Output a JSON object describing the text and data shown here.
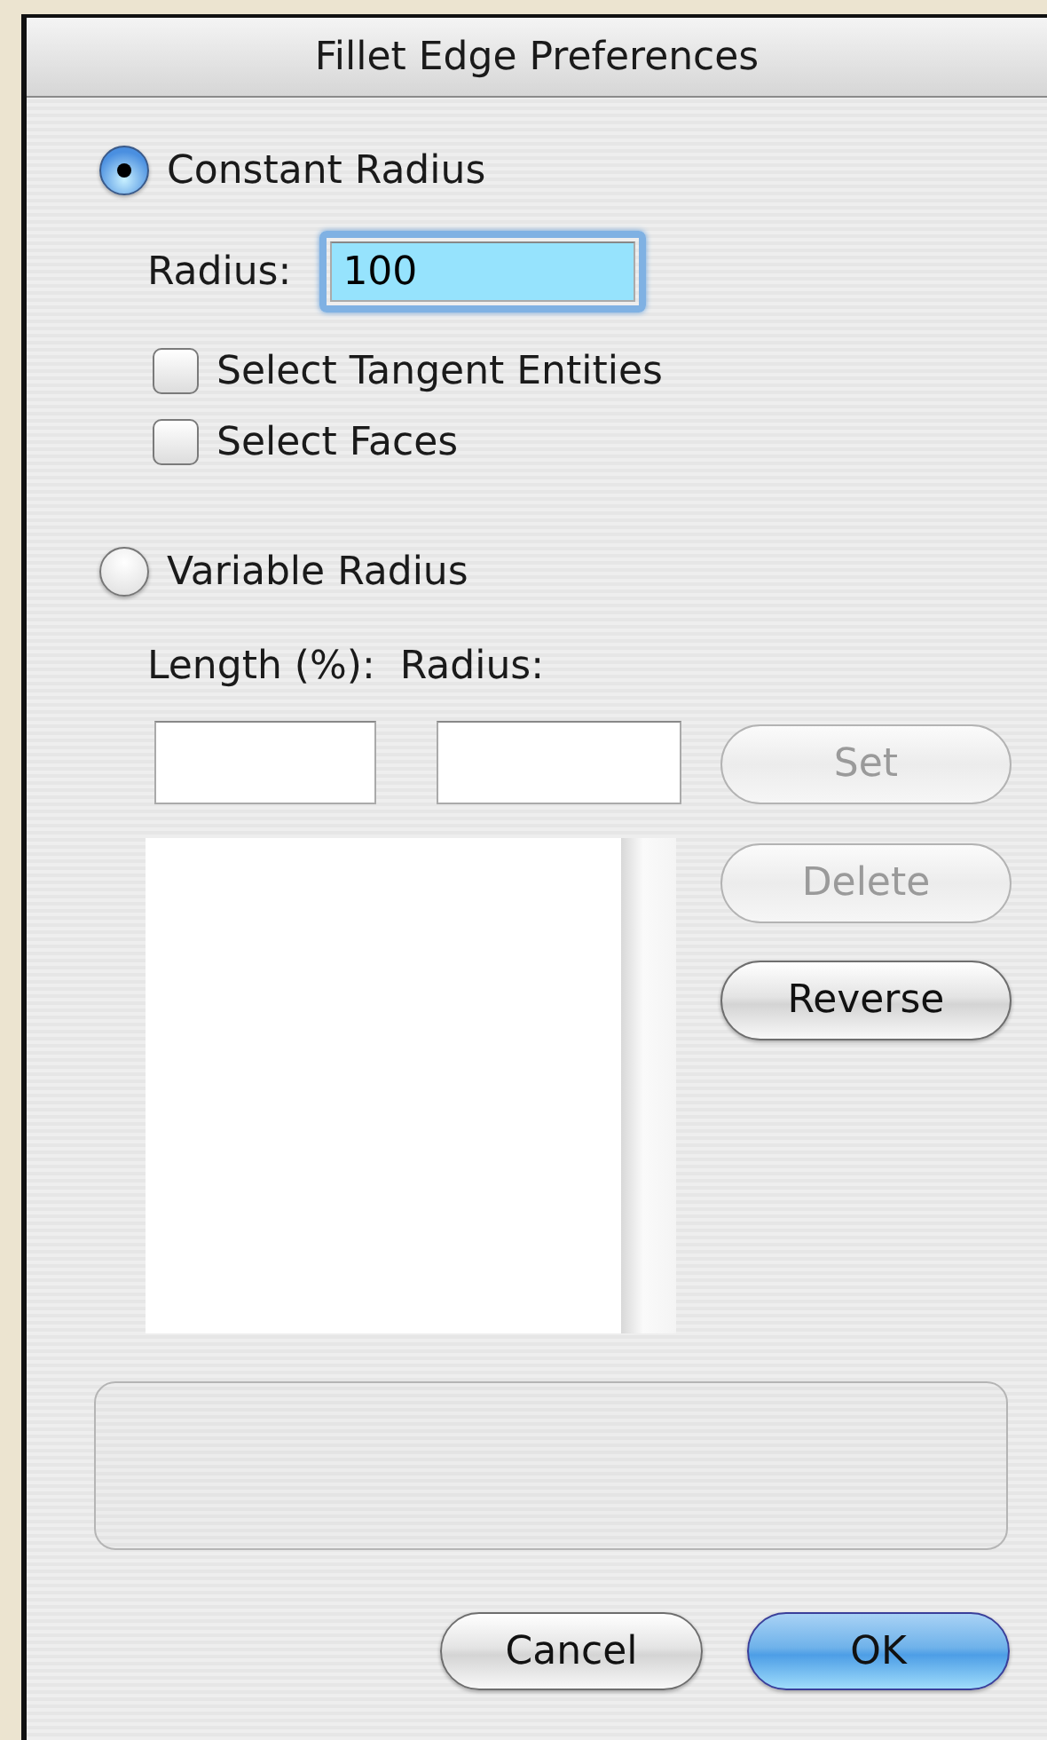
{
  "window": {
    "title": "Fillet Edge Preferences"
  },
  "modes": [
    {
      "label": "Constant Radius",
      "selected": true
    },
    {
      "label": "Variable Radius",
      "selected": false
    }
  ],
  "radius": {
    "label": "Radius:",
    "value": "100",
    "focused": true
  },
  "options": [
    {
      "label": "Select Tangent Entities",
      "checked": false
    },
    {
      "label": "Select Faces",
      "checked": false
    }
  ],
  "variable": {
    "length_label": "Length (%):",
    "radius_label": "Radius:"
  },
  "side_buttons": [
    {
      "label": "Set",
      "disabled": true
    },
    {
      "label": "Delete",
      "disabled": true
    },
    {
      "label": "Reverse",
      "disabled": false
    }
  ],
  "buttons": [
    {
      "label": "Cancel",
      "default": false
    },
    {
      "label": "OK",
      "default": true
    }
  ]
}
